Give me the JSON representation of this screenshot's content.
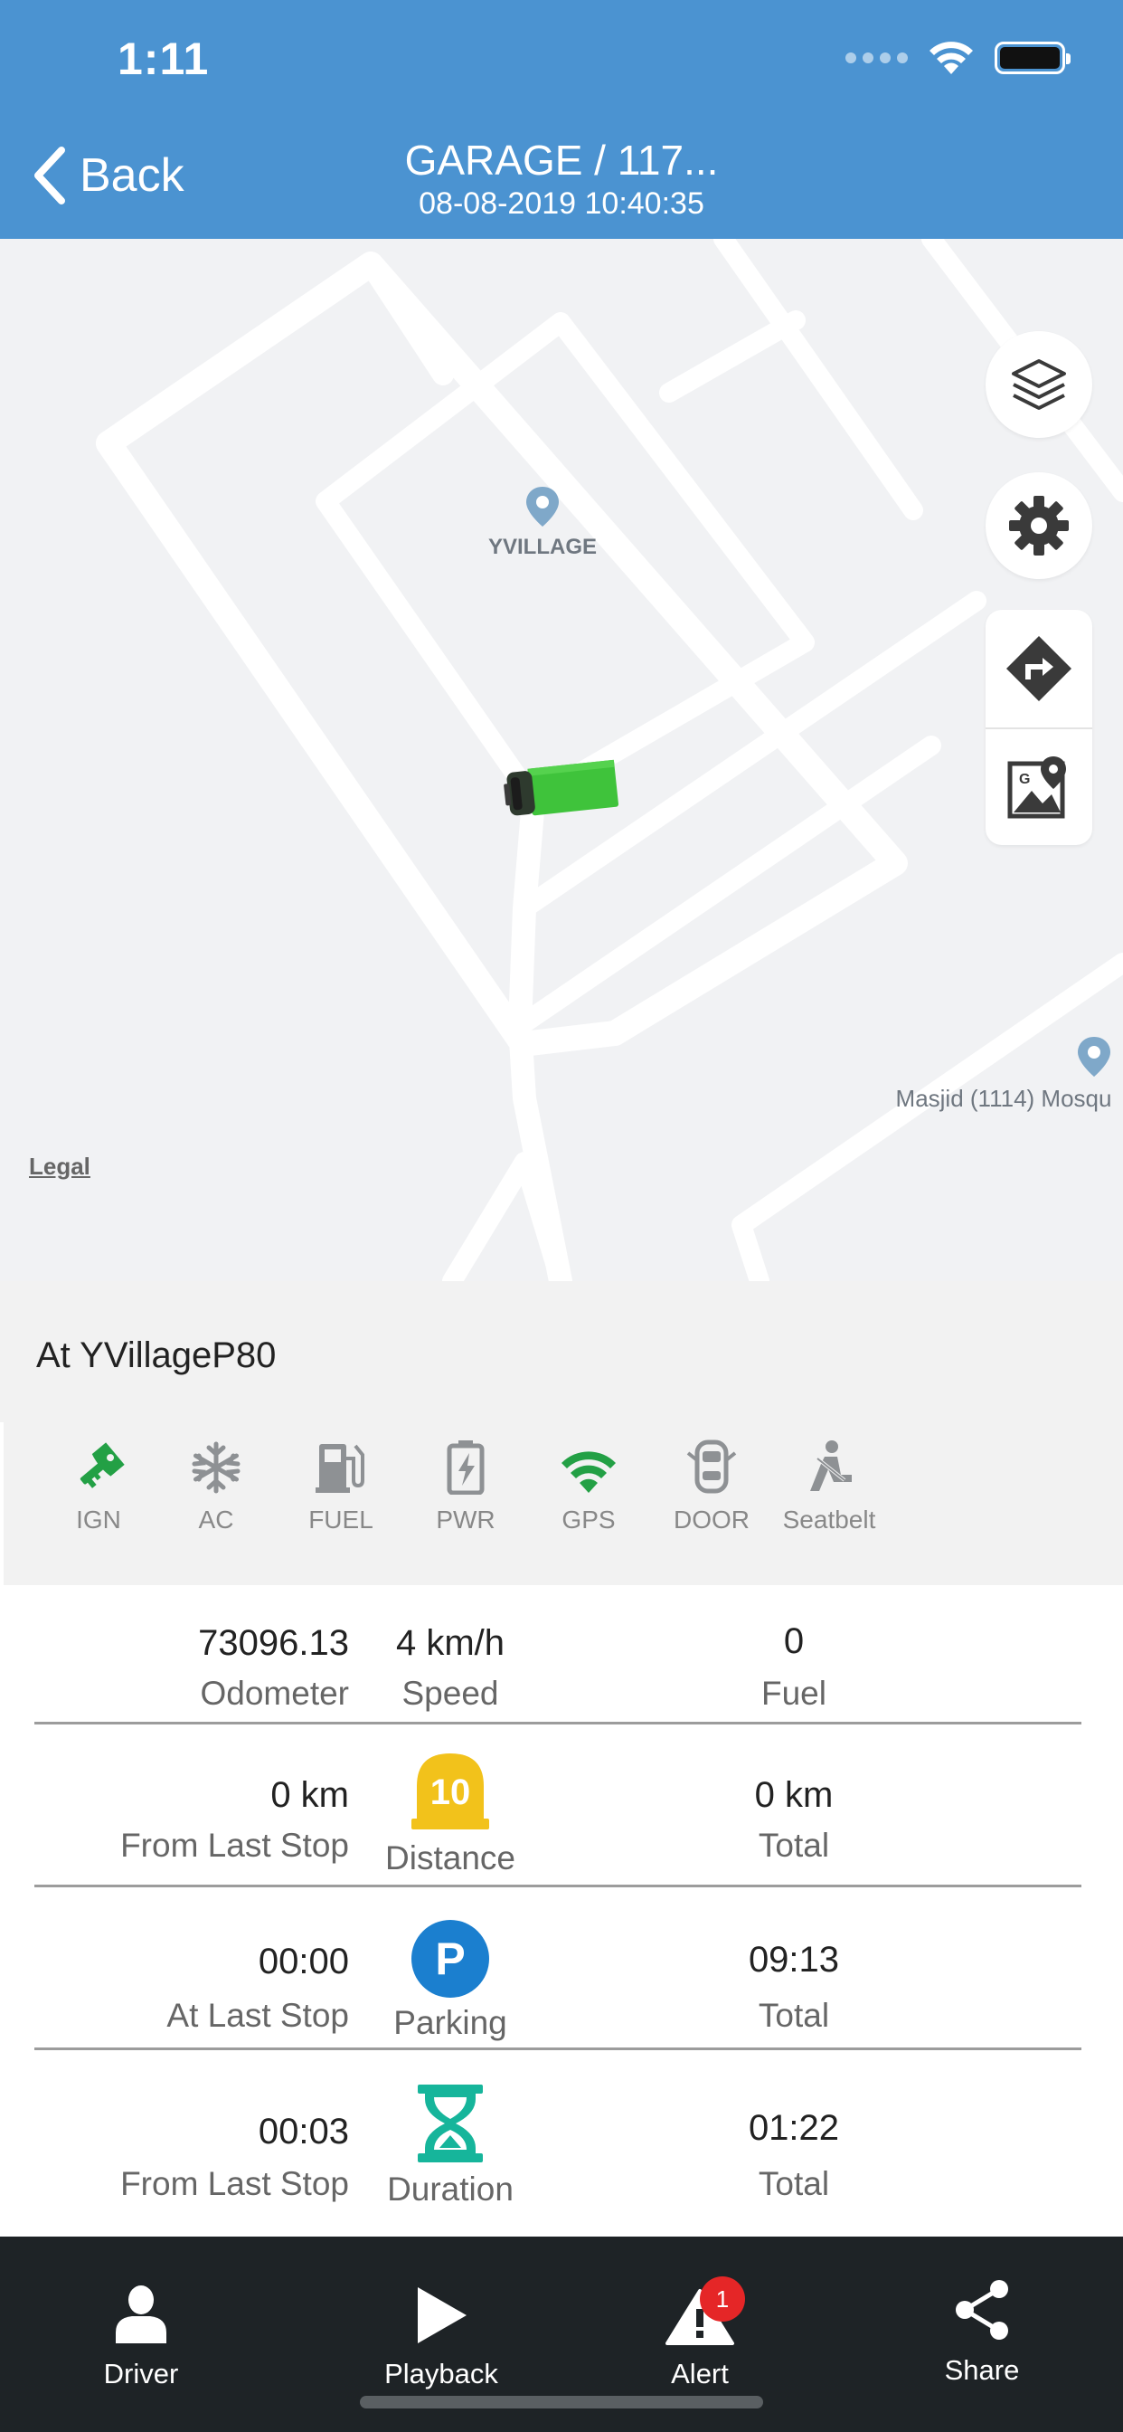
{
  "status_bar": {
    "time": "1:11"
  },
  "nav": {
    "back_label": "Back",
    "title": "GARAGE / 117...",
    "subtitle": "08-08-2019 10:40:35"
  },
  "map": {
    "pois": [
      {
        "label": "YVILLAGE"
      },
      {
        "label": "Masjid (1114) Mosqu"
      }
    ],
    "legal_label": "Legal",
    "controls": [
      "layers-icon",
      "gear-icon",
      "directions-icon",
      "google-maps-icon"
    ],
    "vehicle_color": "#3FC33B"
  },
  "location": {
    "text": "At YVillageP80"
  },
  "status_indicators": [
    {
      "label": "IGN",
      "icon": "key-icon",
      "active": true
    },
    {
      "label": "AC",
      "icon": "snowflake-icon",
      "active": false
    },
    {
      "label": "FUEL",
      "icon": "fuel-pump-icon",
      "active": false
    },
    {
      "label": "PWR",
      "icon": "battery-icon",
      "active": false
    },
    {
      "label": "GPS",
      "icon": "wifi-signal-icon",
      "active": true
    },
    {
      "label": "DOOR",
      "icon": "car-door-icon",
      "active": false
    },
    {
      "label": "Seatbelt",
      "icon": "seatbelt-icon",
      "active": false
    }
  ],
  "metrics": {
    "row1": {
      "odometer_value": "73096.13",
      "odometer_label": "Odometer",
      "speed_value": "4 km/h",
      "speed_label": "Speed",
      "fuel_value": "0",
      "fuel_label": "Fuel"
    },
    "distance": {
      "left_value": "0 km",
      "left_label": "From Last Stop",
      "icon_text": "10",
      "label": "Distance",
      "right_value": "0 km",
      "right_label": "Total"
    },
    "parking": {
      "left_value": "00:00",
      "left_label": "At Last Stop",
      "icon_text": "P",
      "label": "Parking",
      "right_value": "09:13",
      "right_label": "Total"
    },
    "duration": {
      "left_value": "00:03",
      "left_label": "From Last Stop",
      "label": "Duration",
      "right_value": "01:22",
      "right_label": "Total"
    }
  },
  "tabbar": {
    "tabs": [
      {
        "label": "Driver",
        "icon": "person-icon"
      },
      {
        "label": "Playback",
        "icon": "play-icon"
      },
      {
        "label": "Alert",
        "icon": "alert-icon",
        "badge": "1"
      },
      {
        "label": "Share",
        "icon": "share-icon"
      }
    ]
  },
  "colors": {
    "header": "#4B93D1",
    "active_green": "#23A045",
    "inactive_gray": "#8E9194",
    "distance_yellow": "#F2C21B",
    "parking_blue": "#1B7FCF",
    "duration_teal": "#16B59B",
    "tabbar": "#1E2326",
    "badge": "#E52627"
  }
}
